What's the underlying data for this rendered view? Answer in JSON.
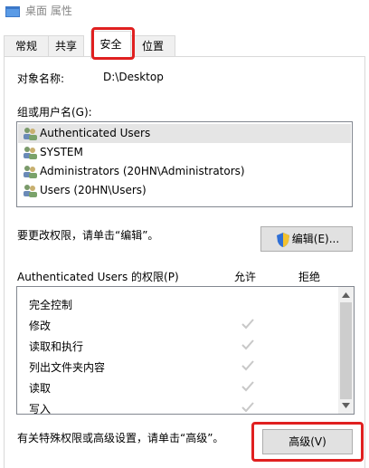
{
  "window": {
    "title": "桌面 属性"
  },
  "tabs": [
    {
      "label": "常规"
    },
    {
      "label": "共享"
    },
    {
      "label": "安全",
      "selected": true
    },
    {
      "label": "位置"
    }
  ],
  "object": {
    "label": "对象名称:",
    "value": "D:\\Desktop"
  },
  "groups": {
    "label": "组或用户名(G):",
    "items": [
      {
        "name": "Authenticated Users",
        "selected": true
      },
      {
        "name": "SYSTEM"
      },
      {
        "name": "Administrators (20HN\\Administrators)"
      },
      {
        "name": "Users (20HN\\Users)"
      }
    ]
  },
  "edit": {
    "hint": "要更改权限，请单击“编辑”。",
    "button_label": "编辑(E)..."
  },
  "permissions": {
    "header": "Authenticated Users 的权限(P)",
    "allow_label": "允许",
    "deny_label": "拒绝",
    "items": [
      {
        "name": "完全控制",
        "allow": false,
        "deny": false
      },
      {
        "name": "修改",
        "allow": true,
        "deny": false
      },
      {
        "name": "读取和执行",
        "allow": true,
        "deny": false
      },
      {
        "name": "列出文件夹内容",
        "allow": true,
        "deny": false
      },
      {
        "name": "读取",
        "allow": true,
        "deny": false
      },
      {
        "name": "写入",
        "allow": true,
        "deny": false
      }
    ]
  },
  "advanced": {
    "hint": "有关特殊权限或高级设置，请单击“高级”。",
    "button_label": "高级(V)"
  },
  "colors": {
    "highlight": "#e02020",
    "check": "#c8c8c8",
    "selection": "#e5e5e5",
    "folder": "#3c78c8"
  }
}
